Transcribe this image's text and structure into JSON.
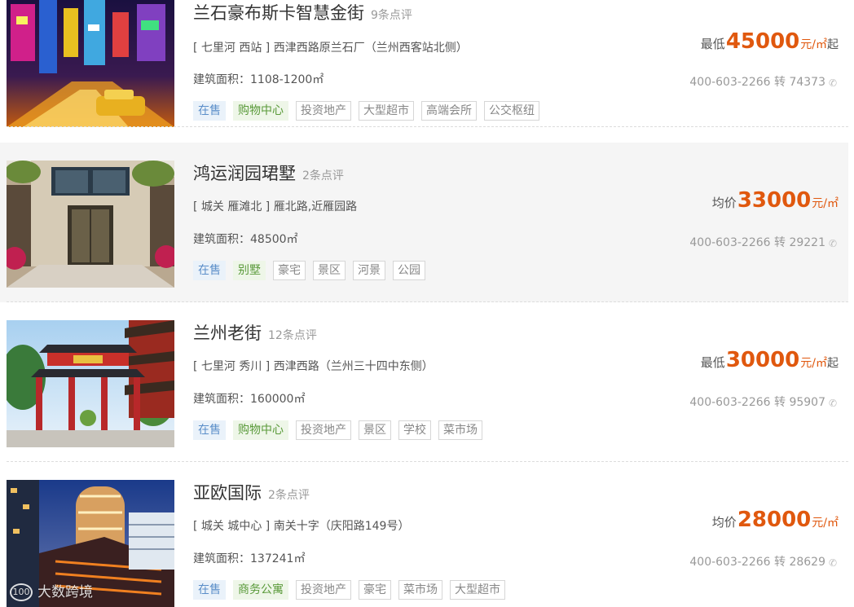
{
  "listings": [
    {
      "title": "兰石豪布斯卡智慧金街",
      "reviews": "9条点评",
      "address": "[ 七里河 西站 ] 西津西路原兰石厂（兰州西客站北侧）",
      "area": "建筑面积：1108-1200㎡",
      "price_label": "最低",
      "price_value": "45000",
      "price_unit": "元/㎡",
      "price_suffix": "起",
      "phone": "400-603-2266 转 74373",
      "tags": [
        "在售",
        "购物中心",
        "投资地产",
        "大型超市",
        "高端会所",
        "公交枢纽"
      ],
      "image": "city-night-street"
    },
    {
      "title": "鸿运润园珺墅",
      "reviews": "2条点评",
      "address": "[ 城关 雁滩北 ] 雁北路,近雁园路",
      "area": "建筑面积：48500㎡",
      "price_label": "均价",
      "price_value": "33000",
      "price_unit": "元/㎡",
      "price_suffix": "",
      "phone": "400-603-2266 转 29221",
      "tags": [
        "在售",
        "别墅",
        "豪宅",
        "景区",
        "河景",
        "公园"
      ],
      "image": "villa-entrance"
    },
    {
      "title": "兰州老街",
      "reviews": "12条点评",
      "address": "[ 七里河 秀川 ] 西津西路（兰州三十四中东侧）",
      "area": "建筑面积：160000㎡",
      "price_label": "最低",
      "price_value": "30000",
      "price_unit": "元/㎡",
      "price_suffix": "起",
      "phone": "400-603-2266 转 95907",
      "tags": [
        "在售",
        "购物中心",
        "投资地产",
        "景区",
        "学校",
        "菜市场"
      ],
      "image": "chinese-gate"
    },
    {
      "title": "亚欧国际",
      "reviews": "2条点评",
      "address": "[ 城关 城中心 ] 南关十字（庆阳路149号）",
      "area": "建筑面积：137241㎡",
      "price_label": "均价",
      "price_value": "28000",
      "price_unit": "元/㎡",
      "price_suffix": "",
      "phone": "400-603-2266 转 28629",
      "tags": [
        "在售",
        "商务公寓",
        "投资地产",
        "豪宅",
        "菜市场",
        "大型超市"
      ],
      "image": "glass-tower-night"
    }
  ],
  "watermark": {
    "logo": "100",
    "text": "大数跨境"
  },
  "colors": {
    "price": "#e0580e",
    "tag_sale_bg": "#eaf2fa",
    "tag_type_bg": "#eef6e8",
    "alt_row_bg": "#f5f5f5"
  }
}
